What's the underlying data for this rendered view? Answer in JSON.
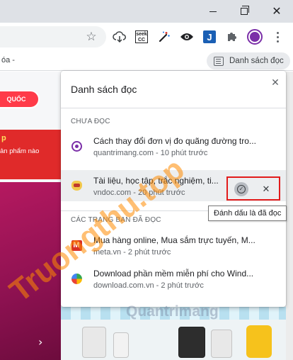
{
  "window": {
    "minimize": "–",
    "maximize": "",
    "close": "✕"
  },
  "toolbar": {
    "star": "☆"
  },
  "extensions": {
    "cc_top": "seek",
    "cc_bottom": "CC",
    "j": "J"
  },
  "bookmarks": {
    "partial": "óa -",
    "reading_list_label": "Danh sách đọc"
  },
  "page": {
    "banner": "QUỐC",
    "banner_p": "p",
    "banner_sub": "ản phẩm nào",
    "arrow": "›"
  },
  "panel": {
    "title": "Danh sách đọc",
    "close": "✕",
    "unread_header": "CHƯA ĐỌC",
    "read_header": "CÁC TRANG BẠN ĐÃ ĐỌC",
    "unread": [
      {
        "title": "Cách thay đổi đơn vị đo quãng đường tro...",
        "meta": "quantrimang.com - 10 phút trước",
        "icon": "quantrimang-favicon-icon"
      },
      {
        "title": "Tài liệu, học tập, trắc nghiệm, ti...",
        "meta": "vndoc.com - 20 phút trước",
        "icon": "vndoc-favicon-icon"
      }
    ],
    "read": [
      {
        "title": "Mua hàng online, Mua sắm trực tuyến, M...",
        "meta": "meta.vn - 2 phút trước",
        "icon": "meta-favicon-icon",
        "icon_text": "M"
      },
      {
        "title": "Download phần mềm miễn phí cho Wind...",
        "meta": "download.com.vn - 2 phút trước",
        "icon": "download-favicon-icon"
      }
    ],
    "item_close": "✕",
    "remove": "✕",
    "mark_read_check": "✓",
    "tooltip": "Đánh dấu là đã đọc"
  },
  "watermark": {
    "text": "Truongthu.top",
    "brand": "Quantrimang"
  },
  "colors": {
    "highlight": "#e21b1b",
    "accent_purple": "#7b2fa8",
    "banner_red": "#e02a2a"
  }
}
